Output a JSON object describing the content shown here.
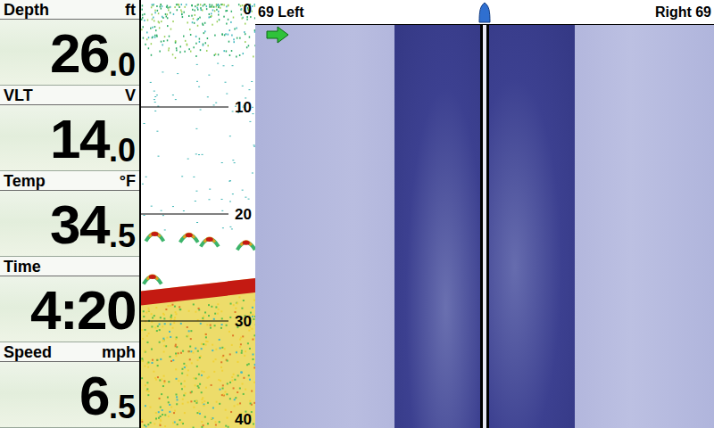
{
  "readouts": [
    {
      "label": "Depth",
      "unit": "ft",
      "value": "26",
      "decimal": ".0"
    },
    {
      "label": "VLT",
      "unit": "V",
      "value": "14",
      "decimal": ".0"
    },
    {
      "label": "Temp",
      "unit": "°F",
      "value": "34",
      "decimal": ".5"
    },
    {
      "label": "Time",
      "value": "4:20",
      "decimal": ""
    },
    {
      "label": "Speed",
      "unit": "mph",
      "value": "6",
      "decimal": ".5"
    }
  ],
  "sonar": {
    "scale": [
      "0",
      "10",
      "20",
      "30",
      "40"
    ],
    "max_depth_ft": 40,
    "bottom_depth_ft": [
      27.2,
      26
    ],
    "fish": [
      {
        "depth": 21.8,
        "time": 0.12
      },
      {
        "depth": 21.9,
        "time": 0.42
      },
      {
        "depth": 22.3,
        "time": 0.6
      },
      {
        "depth": 22.6,
        "time": 0.92
      },
      {
        "depth": 25.8,
        "time": 0.1
      }
    ]
  },
  "side_imaging": {
    "left_label": "69 Left",
    "right_label": "Right 69"
  }
}
